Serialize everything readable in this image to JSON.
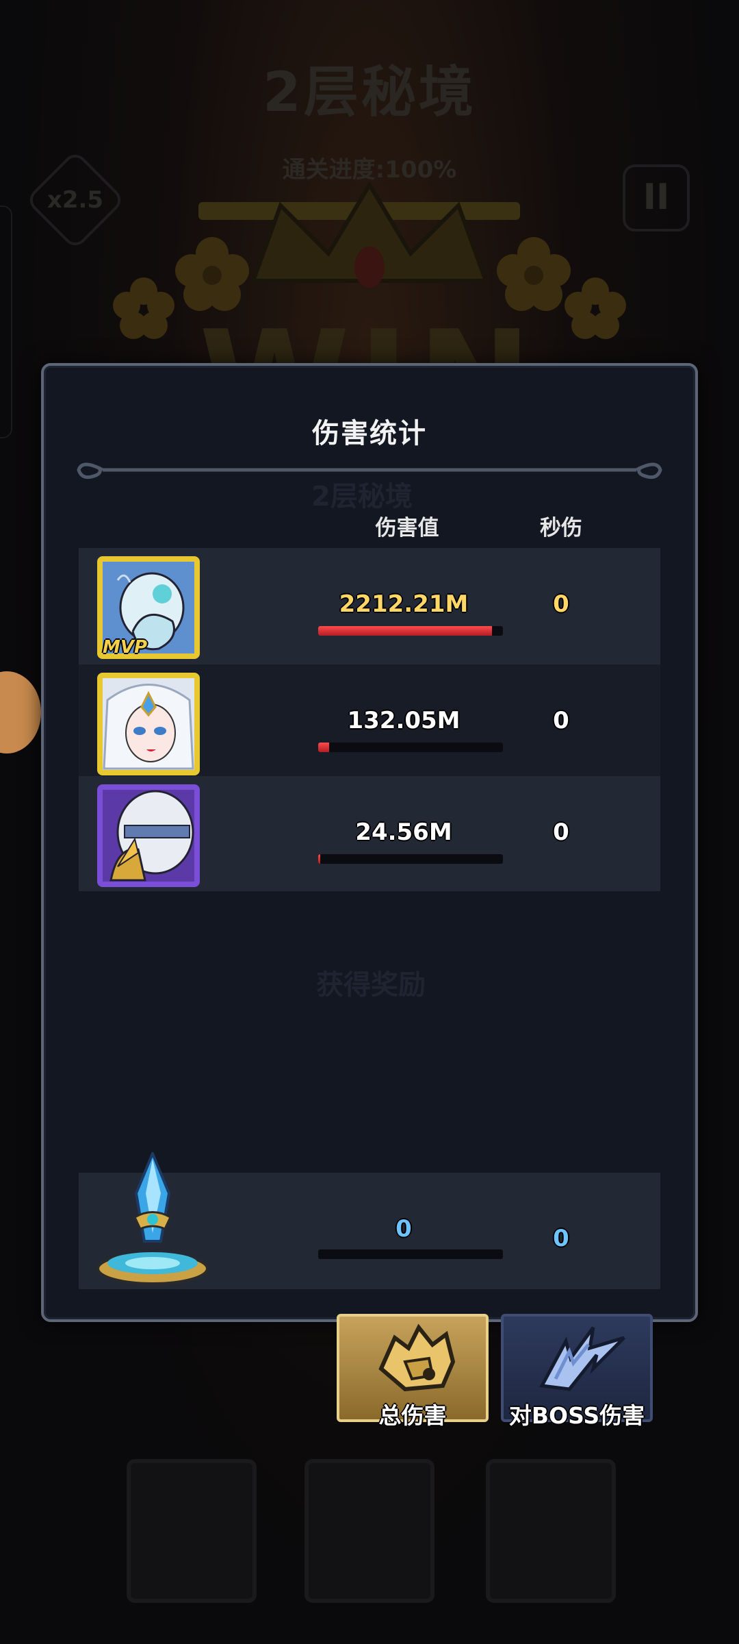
{
  "background": {
    "stage_title": "2层秘境",
    "progress_text": "通关进度:100%",
    "speed_label": "x2.5",
    "pause_label": "II",
    "win_text": "WIN",
    "ghost_stage": "2层秘境",
    "ghost_rewards": "获得奖励"
  },
  "panel": {
    "title": "伤害统计",
    "headers": {
      "damage": "伤害值",
      "dps": "秒伤"
    },
    "rows": [
      {
        "hero_icon": "frost-ghost-hero-icon",
        "mvp": "MVP",
        "damage": "2212.21M",
        "damage_share": 0.94,
        "dps": "0",
        "frame_color": "#e8c830"
      },
      {
        "hero_icon": "ice-queen-hero-icon",
        "damage": "132.05M",
        "damage_share": 0.06,
        "dps": "0",
        "frame_color": "#e8c830"
      },
      {
        "hero_icon": "silver-knight-hero-icon",
        "damage": "24.56M",
        "damage_share": 0.011,
        "dps": "0",
        "frame_color": "#7a4ed6"
      }
    ],
    "summon": {
      "icon": "crystal-totem-icon",
      "damage": "0",
      "damage_share": 0,
      "dps": "0"
    }
  },
  "tabs": {
    "total": {
      "label": "总伤害",
      "icon": "fist-gauntlet-icon"
    },
    "boss": {
      "label": "对BOSS伤害",
      "icon": "lightning-claw-icon"
    }
  },
  "colors": {
    "mvp_gold": "#ffd766",
    "summon_blue": "#6fc3ff",
    "bar_red": "#e0363a",
    "panel_bg": "#121722"
  }
}
